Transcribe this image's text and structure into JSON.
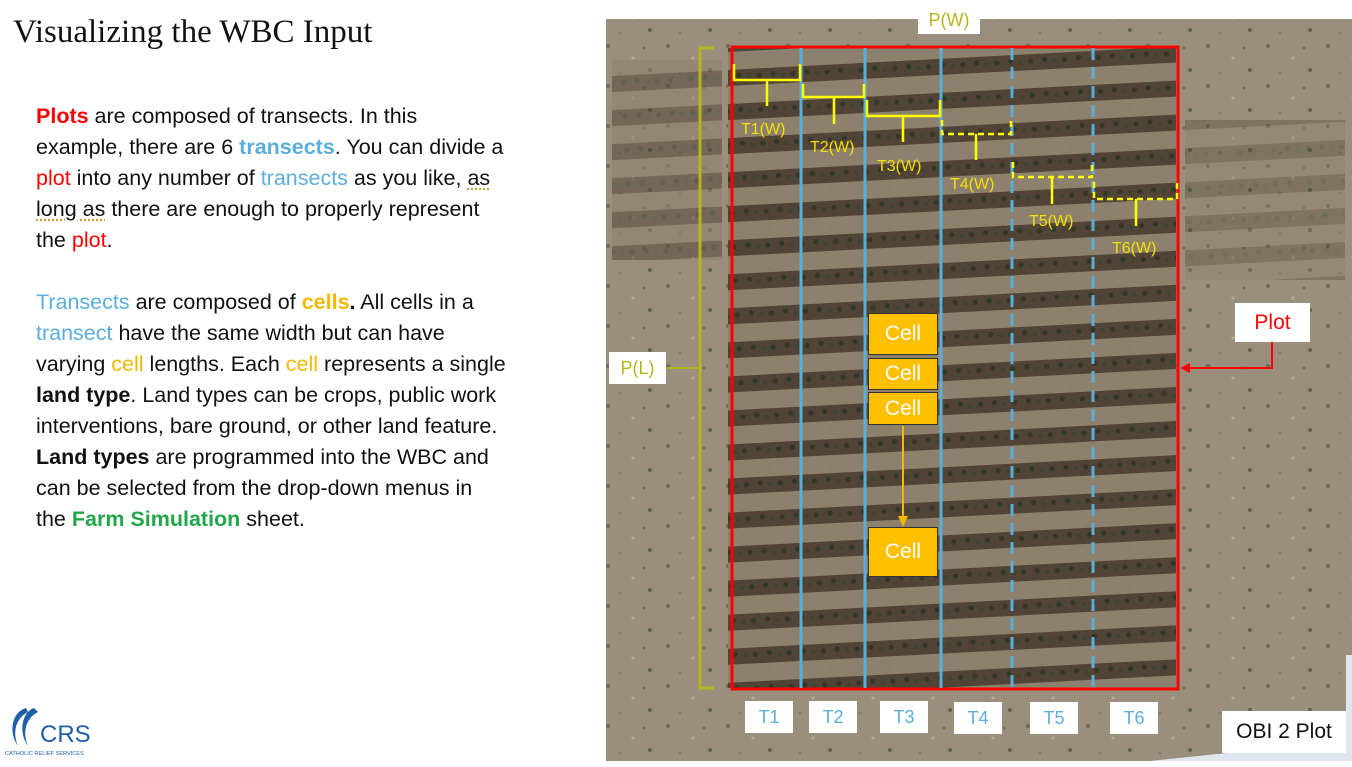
{
  "title": "Visualizing the WBC Input",
  "para1": {
    "s1": "Plots",
    "s2": " are composed of transects. In this example, there are 6 ",
    "s3": "transects",
    "s4": ". You can divide a ",
    "s5": "plot",
    "s6": " into any number of ",
    "s7": "transects",
    "s8": " as you like, ",
    "s9": "as long as",
    "s10": " there are enough to properly represent the ",
    "s11": "plot",
    "s12": "."
  },
  "para2": {
    "s1": "Transects",
    "s2": " are composed of ",
    "s3": "cells",
    "s4": ".",
    "s5": " All cells in a ",
    "s6": "transect",
    "s7": " have the same width but can have varying ",
    "s8": "cell",
    "s9": " lengths. Each ",
    "s10": "cell",
    "s11": " represents a single ",
    "s12": "land type",
    "s13": ". Land types can be crops, public work interventions, bare ground, or other land feature. ",
    "s14": "Land types",
    "s15": " are programmed into the WBC and can be selected from the drop-down menus in the ",
    "s16": "Farm Simulation",
    "s17": " sheet."
  },
  "logo": {
    "name": "CRS",
    "subtitle": "CATHOLIC RELIEF SERVICES"
  },
  "figure": {
    "pw_label": "P(W)",
    "pl_label": "P(L)",
    "plot_label": "Plot",
    "caption": "OBI 2 Plot",
    "transects": [
      "T1",
      "T2",
      "T3",
      "T4",
      "T5",
      "T6"
    ],
    "transect_widths": [
      "T1(W)",
      "T2(W)",
      "T3(W)",
      "T4(W)",
      "T5(W)",
      "T6(W)"
    ],
    "cells": [
      "Cell",
      "Cell",
      "Cell",
      "Cell"
    ]
  }
}
